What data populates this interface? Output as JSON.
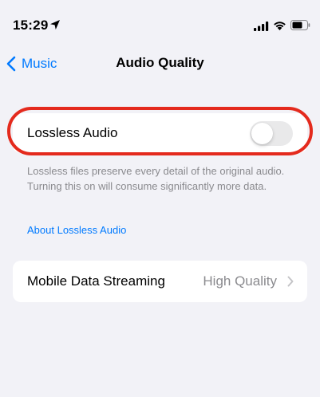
{
  "status_bar": {
    "time": "15:29",
    "icons": [
      "location-arrow-icon",
      "cellular-signal-icon",
      "wifi-icon",
      "battery-icon"
    ]
  },
  "nav": {
    "back_label": "Music",
    "title": "Audio Quality"
  },
  "lossless": {
    "label": "Lossless Audio",
    "toggle_on": false,
    "description": "Lossless files preserve every detail of the original audio. Turning this on will consume significantly more data.",
    "link": "About Lossless Audio"
  },
  "mobile_data": {
    "label": "Mobile Data Streaming",
    "value": "High Quality"
  },
  "colors": {
    "accent": "#007aff",
    "background": "#f2f2f7",
    "secondary_text": "#8a8a8e",
    "highlight": "#e42a1d",
    "toggle_off": "#e9e9ea"
  }
}
